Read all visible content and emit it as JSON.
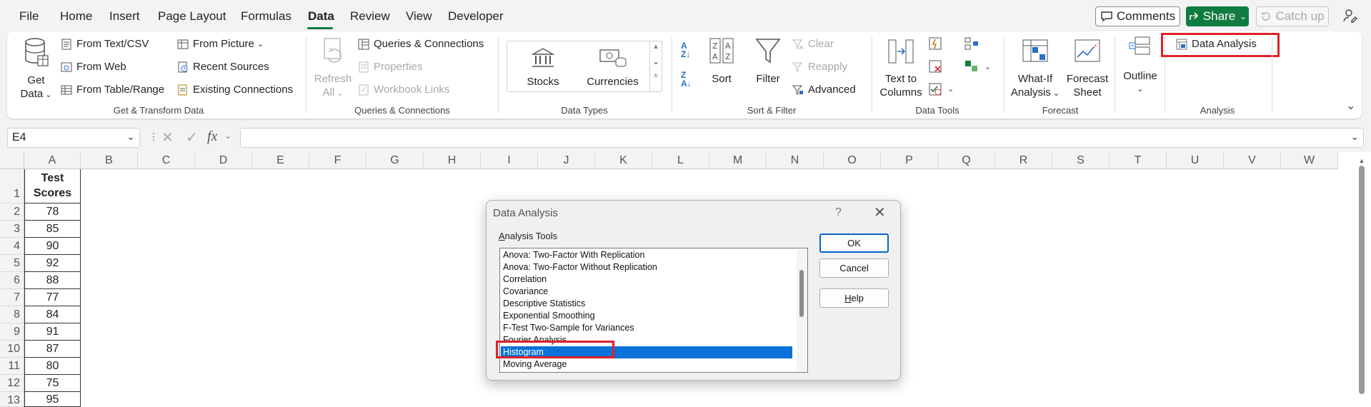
{
  "menu": {
    "items": [
      "File",
      "Home",
      "Insert",
      "Page Layout",
      "Formulas",
      "Data",
      "Review",
      "View",
      "Developer"
    ],
    "active": "Data",
    "comments_label": "Comments",
    "share_label": "Share",
    "catchup_label": "Catch up"
  },
  "ribbon": {
    "get_transform": {
      "label": "Get & Transform Data",
      "get_data_line1": "Get",
      "get_data_line2": "Data",
      "from_text_csv": "From Text/CSV",
      "from_web": "From Web",
      "from_table_range": "From Table/Range",
      "from_picture": "From Picture",
      "recent_sources": "Recent Sources",
      "existing_connections": "Existing Connections"
    },
    "queries": {
      "label": "Queries & Connections",
      "refresh_line1": "Refresh",
      "refresh_line2": "All",
      "queries_connections": "Queries & Connections",
      "properties": "Properties",
      "workbook_links": "Workbook Links"
    },
    "data_types": {
      "label": "Data Types",
      "stocks": "Stocks",
      "currencies": "Currencies"
    },
    "sort_filter": {
      "label": "Sort & Filter",
      "sort": "Sort",
      "filter": "Filter",
      "clear": "Clear",
      "reapply": "Reapply",
      "advanced": "Advanced"
    },
    "data_tools": {
      "label": "Data Tools",
      "text_to_columns_line1": "Text to",
      "text_to_columns_line2": "Columns"
    },
    "forecast": {
      "label": "Forecast",
      "whatif_line1": "What-If",
      "whatif_line2": "Analysis",
      "forecast_line1": "Forecast",
      "forecast_line2": "Sheet"
    },
    "outline": {
      "label": "Outline"
    },
    "analysis": {
      "label": "Analysis",
      "data_analysis": "Data Analysis"
    }
  },
  "formula_bar": {
    "name_box": "E4",
    "fx": "fx",
    "value": ""
  },
  "sheet": {
    "columns": [
      "A",
      "B",
      "C",
      "D",
      "E",
      "F",
      "G",
      "H",
      "I",
      "J",
      "K",
      "L",
      "M",
      "N",
      "O",
      "P",
      "Q",
      "R",
      "S",
      "T",
      "U",
      "V",
      "W"
    ],
    "rows": [
      "1",
      "2",
      "3",
      "4",
      "5",
      "6",
      "7",
      "8",
      "9",
      "10",
      "11",
      "12",
      "13"
    ],
    "header_line1": "Test",
    "header_line2": "Scores",
    "scores": [
      "78",
      "85",
      "90",
      "92",
      "88",
      "77",
      "84",
      "91",
      "87",
      "80",
      "75",
      "95"
    ]
  },
  "dialog": {
    "title": "Data Analysis",
    "help_glyph": "?",
    "close_glyph": "✕",
    "list_label": "Analysis Tools",
    "tools": [
      "Anova: Two-Factor With Replication",
      "Anova: Two-Factor Without Replication",
      "Correlation",
      "Covariance",
      "Descriptive Statistics",
      "Exponential Smoothing",
      "F-Test Two-Sample for Variances",
      "Fourier Analysis",
      "Histogram",
      "Moving Average"
    ],
    "selected": "Histogram",
    "ok": "OK",
    "cancel": "Cancel",
    "help": "Help"
  },
  "colors": {
    "accent_green": "#107c41",
    "highlight_red": "#e0202a",
    "selection_blue": "#0a72d9"
  }
}
